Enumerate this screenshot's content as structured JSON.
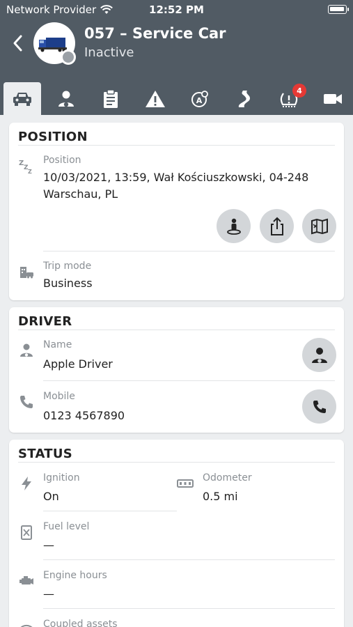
{
  "status_bar": {
    "carrier": "Network Provider",
    "time": "12:52 PM"
  },
  "header": {
    "vehicle_name": "057 – Service Car",
    "vehicle_state": "Inactive",
    "back_icon": "chevron-left-icon"
  },
  "tabs": [
    {
      "icon": "car-icon",
      "active": true
    },
    {
      "icon": "driver-icon",
      "active": false
    },
    {
      "icon": "clipboard-icon",
      "active": false
    },
    {
      "icon": "warning-icon",
      "active": false
    },
    {
      "icon": "route-pin-icon",
      "active": false
    },
    {
      "icon": "road-icon",
      "active": false
    },
    {
      "icon": "tire-pressure-icon",
      "active": false,
      "badge": "4"
    },
    {
      "icon": "video-icon",
      "active": false
    }
  ],
  "position_card": {
    "title": "POSITION",
    "position_label": "Position",
    "position_value_line1": "10/03/2021, 13:59, Wał Kościuszkowski, 04-248",
    "position_value_line2": "Warschau, PL",
    "trip_mode_label": "Trip mode",
    "trip_mode_value": "Business"
  },
  "driver_card": {
    "title": "DRIVER",
    "name_label": "Name",
    "name_value": "Apple Driver",
    "mobile_label": "Mobile",
    "mobile_value": "0123 4567890"
  },
  "status_card": {
    "title": "STATUS",
    "ignition_label": "Ignition",
    "ignition_value": "On",
    "odometer_label": "Odometer",
    "odometer_value": "0.5 mi",
    "fuel_label": "Fuel level",
    "fuel_value": "—",
    "engine_label": "Engine hours",
    "engine_value": "—",
    "coupled_label": "Coupled assets"
  },
  "colors": {
    "header_bg": "#515b64",
    "badge": "#e53935",
    "round_button": "#d3d6d9",
    "page_bg": "#eceef0"
  }
}
